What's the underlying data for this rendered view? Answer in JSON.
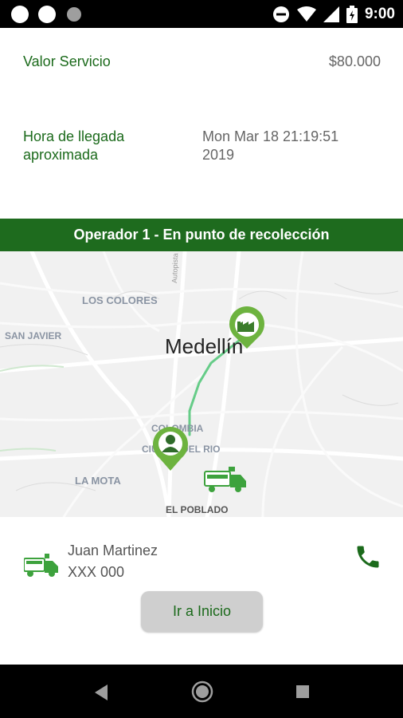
{
  "status_bar": {
    "time": "9:00"
  },
  "service": {
    "value_label": "Valor Servicio",
    "value_amount": "$80.000",
    "eta_label_line1": "Hora de llegada",
    "eta_label_line2": "aproximada",
    "eta_value_line1": "Mon Mar 18 21:19:51",
    "eta_value_line2": "2019"
  },
  "banner": {
    "text": "Operador 1 - En punto de recolección"
  },
  "map": {
    "city_label": "Medellín",
    "labels": {
      "los_colores": "LOS COLORES",
      "san_javier": "SAN JAVIER",
      "colombia": "COLOMBIA",
      "castilla_rio": "CIUDAD DEL RIO",
      "la_mota": "LA MOTA",
      "el_poblado": "EL POBLADO",
      "autopista": "Autopista"
    }
  },
  "driver": {
    "name": "Juan Martinez",
    "plate": "XXX 000"
  },
  "actions": {
    "home_label": "Ir a Inicio"
  },
  "colors": {
    "brand_green": "#1e6b1e",
    "route_green": "#66cc88"
  },
  "icons": {
    "truck": "truck-icon",
    "phone": "phone-icon",
    "factory": "factory-pin-icon",
    "person": "person-pin-icon"
  }
}
